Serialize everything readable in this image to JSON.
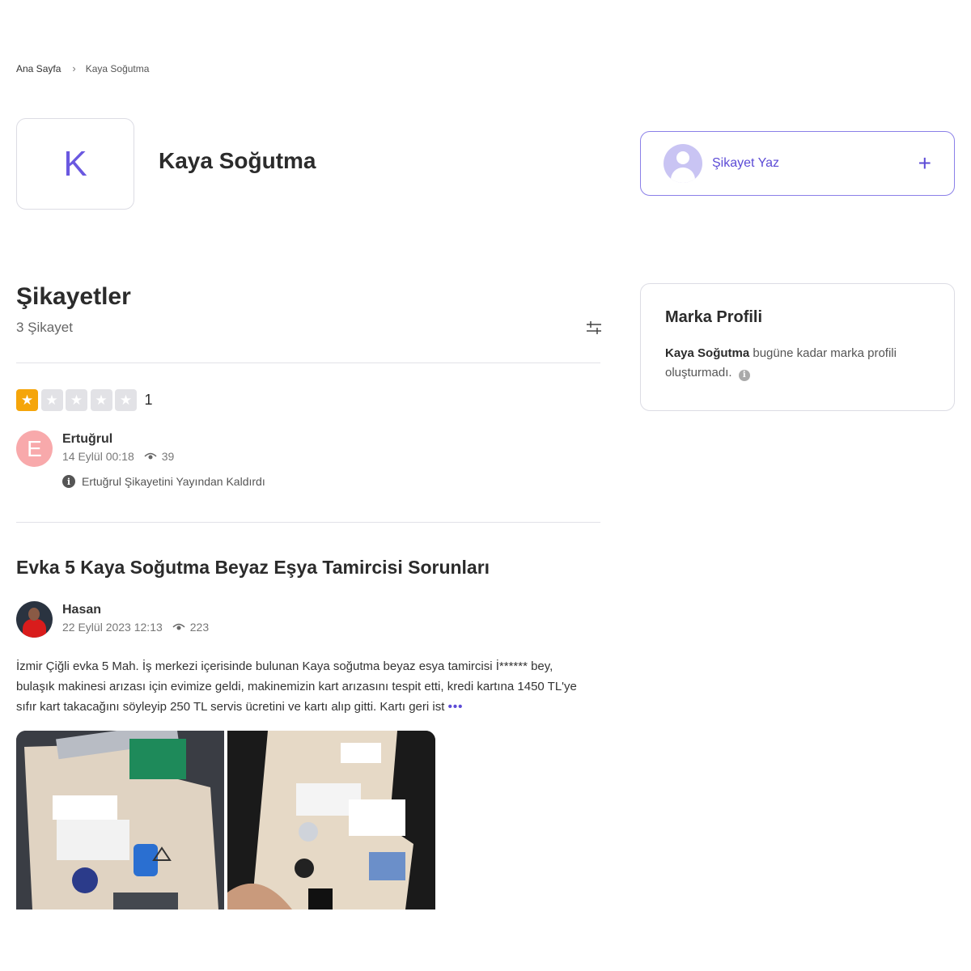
{
  "breadcrumb": {
    "home": "Ana Sayfa",
    "separator": "›",
    "current": "Kaya Soğutma"
  },
  "brand": {
    "logo_letter": "K",
    "name": "Kaya Soğutma"
  },
  "write_complaint": {
    "label": "Şikayet Yaz",
    "plus": "+"
  },
  "complaints_section": {
    "title": "Şikayetler",
    "count": "3 Şikayet"
  },
  "rating": {
    "value": "1",
    "filled_stars": 1,
    "total_stars": 5
  },
  "removed_item": {
    "avatar_letter": "E",
    "user": "Ertuğrul",
    "date": "14 Eylül 00:18",
    "views": "39",
    "notice": "Ertuğrul Şikayetini Yayından Kaldırdı"
  },
  "complaint": {
    "title": "Evka 5 Kaya Soğutma Beyaz Eşya Tamircisi Sorunları",
    "user": "Hasan",
    "date": "22 Eylül 2023 12:13",
    "views": "223",
    "text": "İzmir Çiğli evka 5 Mah. İş merkezi içerisinde bulunan Kaya soğutma beyaz esya tamircisi İ****** bey, bulaşık makinesi arızası için evimize geldi, makinemizin kart arızasını tespit etti, kredi kartına 1450 TL'ye sıfır kart takacağını söyleyip 250 TL servis ücretini ve kartı alıp gitti. Kartı geri ist",
    "more": "•••"
  },
  "brand_profile": {
    "title": "Marka Profili",
    "brand_name": "Kaya Soğutma",
    "text": "bugüne kadar marka profili oluşturmadı.",
    "info": "i"
  },
  "colors": {
    "accent": "#5c4bd6",
    "star": "#f5a50a",
    "star_off": "#e2e2e6",
    "avatar_e": "#f8a9ab"
  }
}
